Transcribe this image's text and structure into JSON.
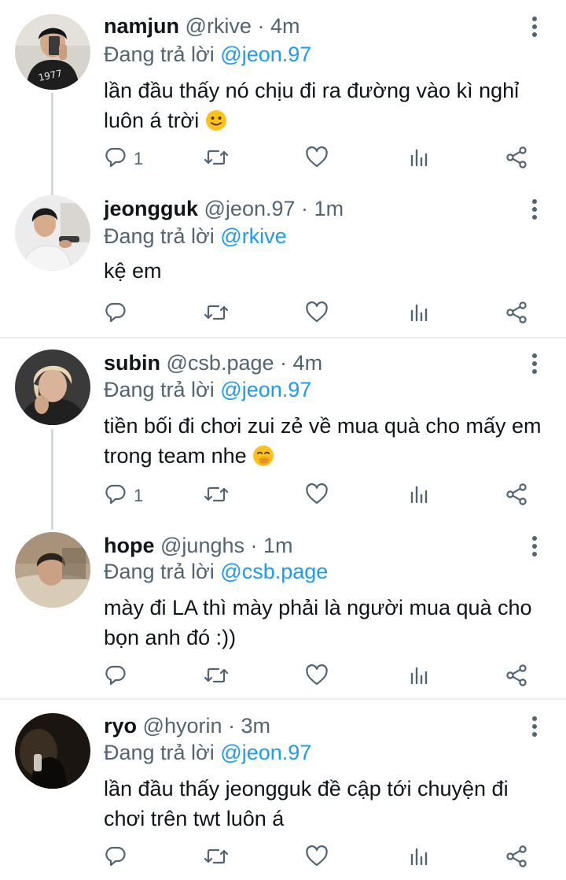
{
  "colors": {
    "accent": "#1d9bf0",
    "muted": "#536471",
    "text": "#0f1419",
    "thread_line": "#cfd9de",
    "divider": "#e6ecf0"
  },
  "reply_prefix": "Đang trả lời",
  "tweets": [
    {
      "name": "namjun",
      "handle": "@rkive",
      "dot": "·",
      "time": "4m",
      "reply_to": "@jeon.97",
      "text": "lần đầu thấy nó chịu đi ra đường vào kì nghỉ luôn á trời",
      "emoji": "slightly-smiling-face",
      "reply_count": "1",
      "retweet_count": "",
      "like_count": ""
    },
    {
      "name": "jeongguk",
      "handle": "@jeon.97",
      "dot": "·",
      "time": "1m",
      "reply_to": "@rkive",
      "text": "kệ em",
      "reply_count": "",
      "retweet_count": "",
      "like_count": ""
    },
    {
      "name": "subin",
      "handle": "@csb.page",
      "dot": "·",
      "time": "4m",
      "reply_to": "@jeon.97",
      "text": "tiền bối đi chơi zui zẻ về mua quà cho mấy em trong team nhe",
      "emoji": "hand-over-mouth-face",
      "reply_count": "1",
      "retweet_count": "",
      "like_count": ""
    },
    {
      "name": "hope",
      "handle": "@junghs",
      "dot": "·",
      "time": "1m",
      "reply_to": "@csb.page",
      "text": "mày đi LA thì mày phải là người mua quà cho bọn anh đó :))",
      "reply_count": "",
      "retweet_count": "",
      "like_count": ""
    },
    {
      "name": "ryo",
      "handle": "@hyorin",
      "dot": "·",
      "time": "3m",
      "reply_to": "@jeon.97",
      "text": "lần đầu thấy jeongguk đề cập tới chuyện đi chơi trên twt luôn á",
      "reply_count": "",
      "retweet_count": "",
      "like_count": ""
    }
  ],
  "icons": [
    "more-vertical-icon",
    "reply-icon",
    "retweet-icon",
    "like-icon",
    "analytics-icon",
    "share-icon"
  ]
}
